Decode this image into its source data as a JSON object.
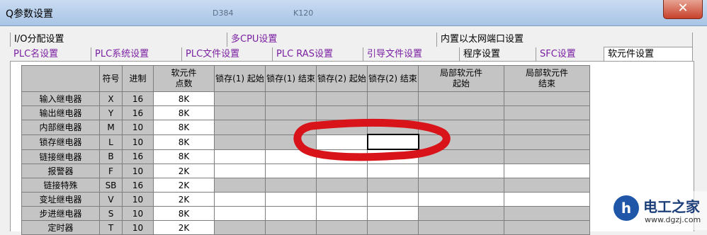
{
  "window": {
    "title": "Q参数设置",
    "background_labels": [
      "D384",
      "K120"
    ],
    "close_glyph": "✕"
  },
  "tabs_row1": [
    "I/O分配设置",
    "多CPU设置",
    "内置以太网端口设置"
  ],
  "tabs_row2": [
    "PLC名设置",
    "PLC系统设置",
    "PLC文件设置",
    "PLC RAS设置",
    "引导文件设置",
    "程序设置",
    "SFC设置",
    "软元件设置"
  ],
  "table": {
    "headers": [
      "",
      "符号",
      "进制",
      "软元件\n点数",
      "锁存(1) 起始",
      "锁存(1) 结束",
      "锁存(2) 起始",
      "锁存(2) 结束",
      "局部软元件\n起始",
      "局部软元件\n结束"
    ],
    "rows": [
      [
        "输入继电器",
        "X",
        "16",
        "8K",
        "",
        "",
        "",
        "",
        "",
        ""
      ],
      [
        "输出继电器",
        "Y",
        "16",
        "8K",
        "",
        "",
        "",
        "",
        "",
        ""
      ],
      [
        "内部继电器",
        "M",
        "10",
        "8K",
        "",
        "",
        "",
        "",
        "",
        ""
      ],
      [
        "锁存继电器",
        "L",
        "10",
        "8K",
        "",
        "",
        "",
        "",
        "",
        ""
      ],
      [
        "链接继电器",
        "B",
        "16",
        "8K",
        "",
        "",
        "",
        "",
        "",
        ""
      ],
      [
        "报警器",
        "F",
        "10",
        "2K",
        "",
        "",
        "",
        "",
        "",
        ""
      ],
      [
        "链接特殊",
        "SB",
        "16",
        "2K",
        "",
        "",
        "",
        "",
        "",
        ""
      ],
      [
        "变址继电器",
        "V",
        "10",
        "2K",
        "",
        "",
        "",
        "",
        "",
        ""
      ],
      [
        "步进继电器",
        "S",
        "10",
        "8K",
        "",
        "",
        "",
        "",
        "",
        ""
      ],
      [
        "定时器",
        "T",
        "10",
        "2K",
        "",
        "",
        "",
        "",
        "",
        ""
      ]
    ]
  },
  "watermark": {
    "logo_text": "h",
    "name": "电工之家",
    "url": "www.dgzj.com"
  },
  "colors": {
    "annotation": "#d8141a",
    "tab_text": "#7a1fa2",
    "cell_gray": "#c4c4c4"
  }
}
